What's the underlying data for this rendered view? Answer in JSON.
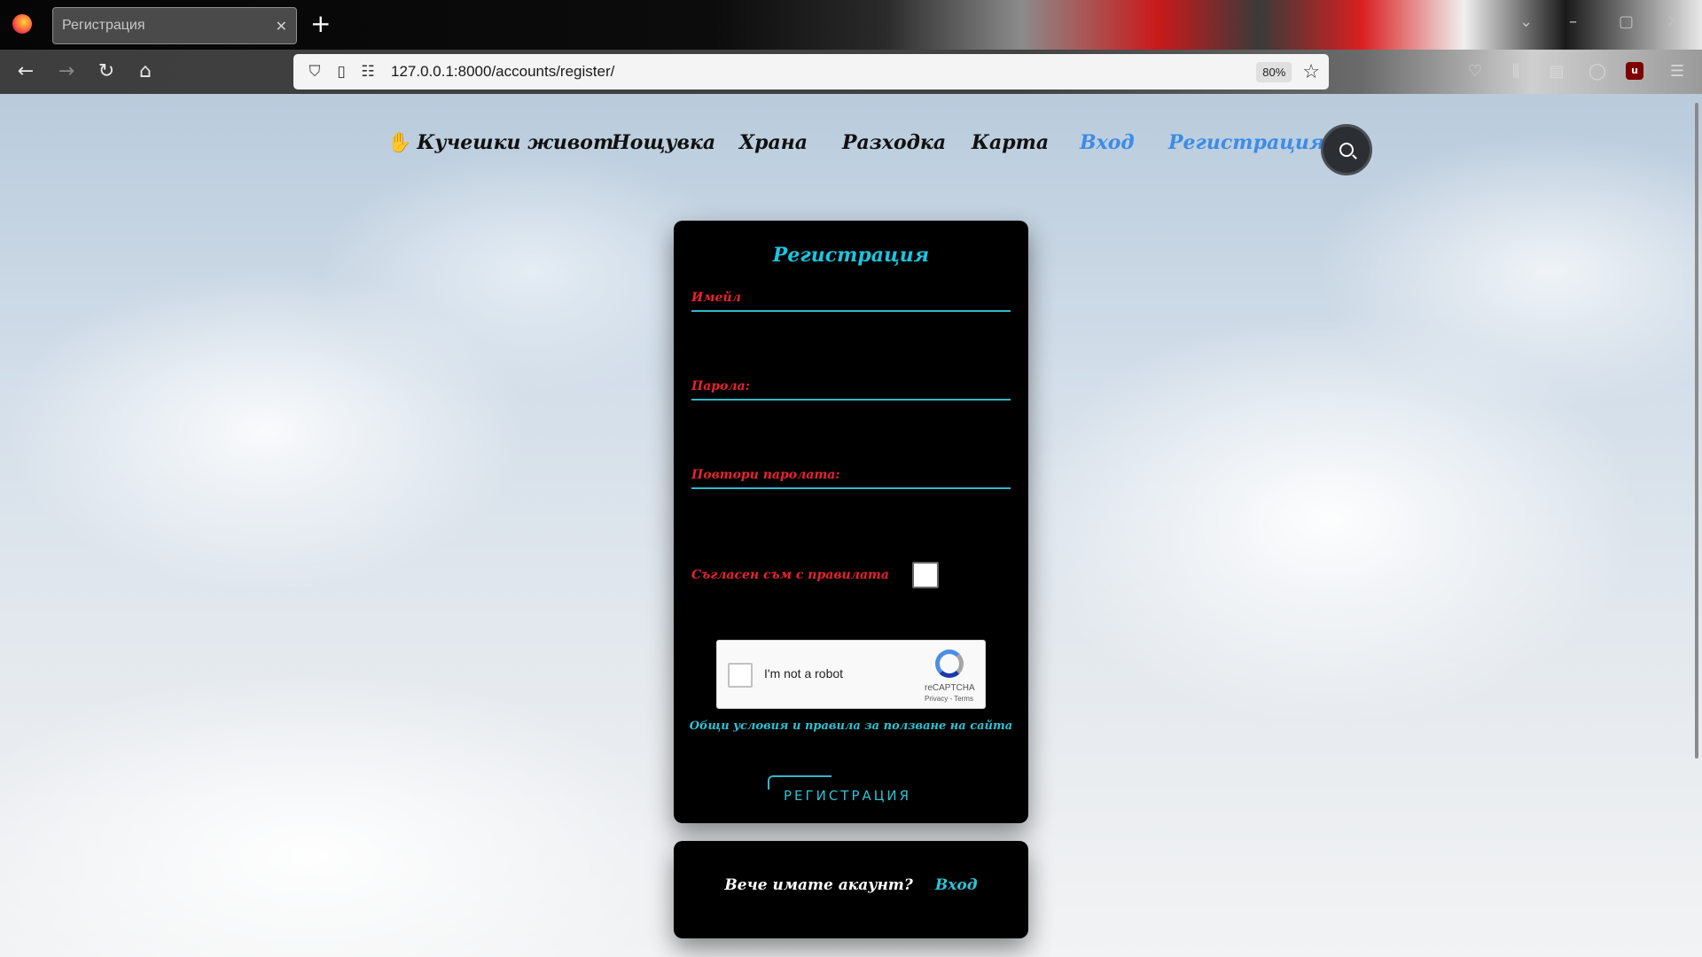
{
  "browser": {
    "tab_title": "Регистрация",
    "tab_close": "✕",
    "new_tab": "+",
    "url_host": "127.0.0.1",
    "url_rest": ":8000/accounts/register/",
    "zoom": "80%",
    "accent": "#3e3e3e"
  },
  "site_nav": {
    "brand": "Кучешки живот",
    "items": [
      "Нощувка",
      "Храна",
      "Разходка",
      "Карта",
      "Вход",
      "Регистрация"
    ],
    "active_color": "#3d8ce6"
  },
  "form": {
    "title": "Регистрация",
    "email_label": "Имейл",
    "password_label": "Парола:",
    "repeat_password_label": "Повтори паролата:",
    "agree_label": "Съгласен съм с правилата",
    "recaptcha_text": "I'm not a robot",
    "recaptcha_brand": "reCAPTCHA",
    "recaptcha_links": "Privacy - Terms",
    "terms_link": "Общи условия и правила за ползване на сайта",
    "submit_label": "РЕГИСТРАЦИЯ",
    "label_color": "#e8232d",
    "accent_color": "#2bc3d6"
  },
  "login_prompt": {
    "text": "Вече имате акаунт?",
    "link": "Вход"
  }
}
